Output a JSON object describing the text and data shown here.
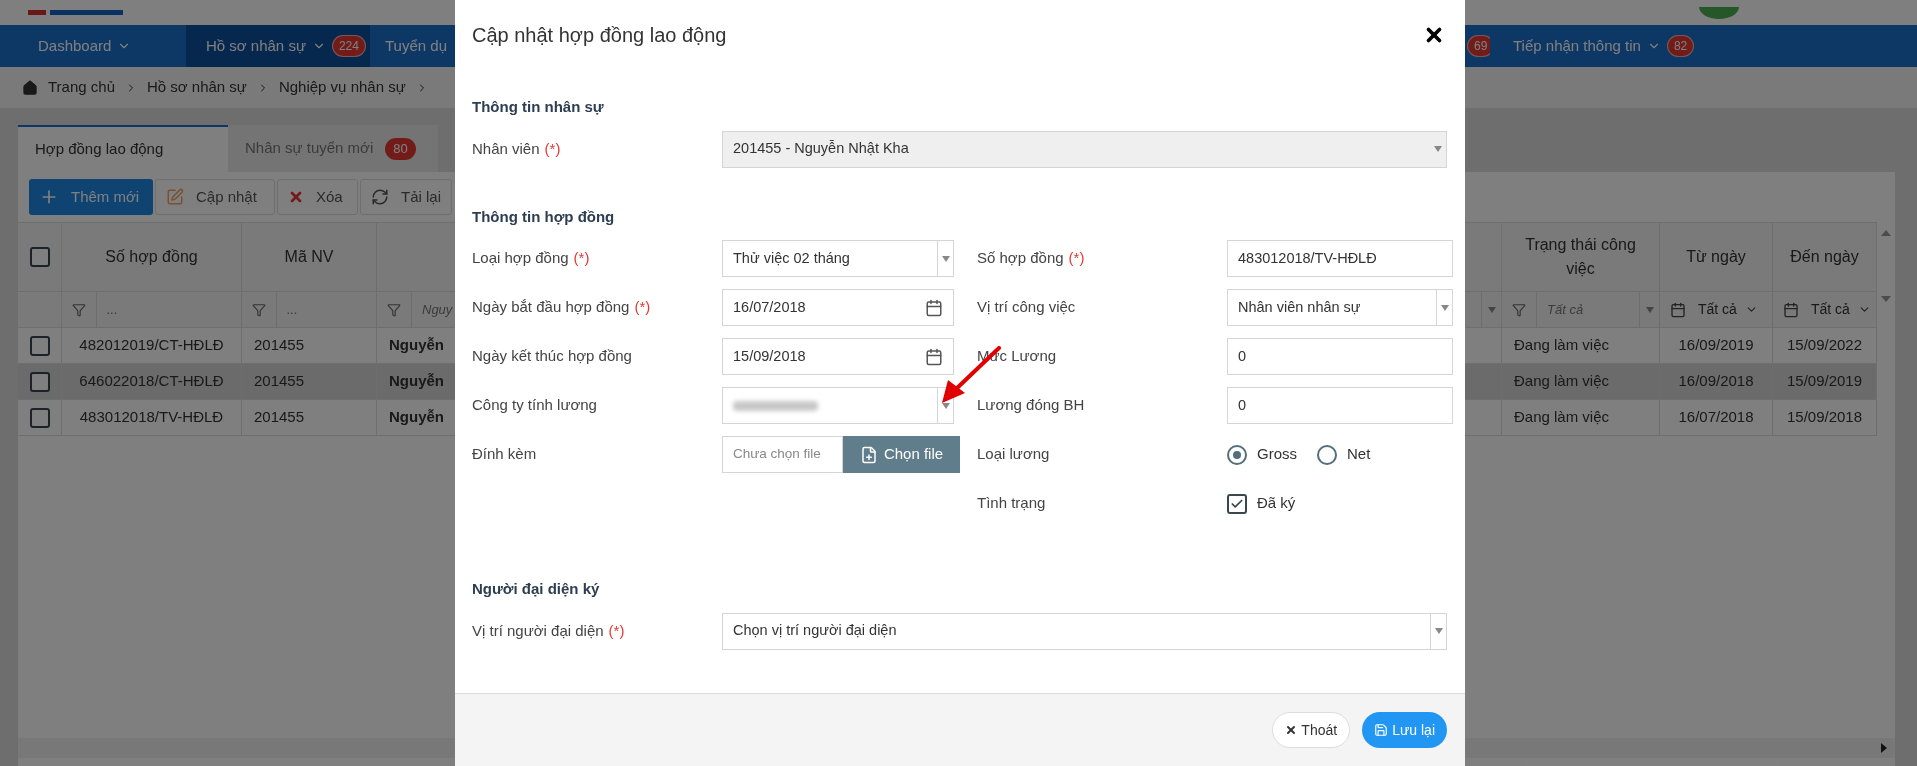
{
  "nav": {
    "left_items": [
      {
        "label": "Dashboard",
        "selected": false,
        "dropdown": true
      },
      {
        "label": "Hồ sơ nhân sự",
        "selected": true,
        "dropdown": true,
        "badge": "224"
      },
      {
        "label": "Tuyển dụ",
        "selected": false
      }
    ],
    "right_items": [
      {
        "badge": "69",
        "selected": false
      },
      {
        "label": "Tiếp nhận thông tin",
        "selected": false,
        "dropdown": true,
        "badge": "82"
      }
    ]
  },
  "breadcrumb": [
    "Trang chủ",
    "Hồ sơ nhân sự",
    "Nghiệp vụ nhân sự"
  ],
  "tabs": [
    {
      "label": "Hợp đồng lao động",
      "selected": true
    },
    {
      "label": "Nhân sự tuyển mới",
      "selected": false,
      "badge": "80"
    }
  ],
  "toolbar": [
    {
      "kind": "add",
      "label": "Thêm mới"
    },
    {
      "kind": "edit",
      "label": "Cập nhật"
    },
    {
      "kind": "delete",
      "label": "Xóa"
    },
    {
      "kind": "reload",
      "label": "Tải lại"
    }
  ],
  "table": {
    "all_checked": false,
    "columns": [
      {
        "label": "Số hợp đồng",
        "filter": {
          "kind": "text",
          "placeholder": "..."
        }
      },
      {
        "label": "Mã NV",
        "filter": {
          "kind": "text",
          "placeholder": "..."
        }
      },
      {
        "filter": {
          "kind": "select",
          "placeholder": "Nguy"
        }
      },
      {
        "label": "Trạng thái công việc",
        "filter": {
          "kind": "select",
          "placeholder": "Tất cả"
        }
      },
      {
        "label": "Từ ngày",
        "filter": {
          "kind": "date",
          "placeholder": "Tất cả"
        }
      },
      {
        "label": "Đến ngày",
        "filter": {
          "kind": "date",
          "placeholder": "Tất cả"
        }
      }
    ],
    "rows": [
      {
        "checked": false,
        "selected": false,
        "cells": [
          "482012019/CT-HĐLĐ",
          "201455",
          "Nguyễn",
          "Đang làm việc",
          "16/09/2019",
          "15/09/2022"
        ]
      },
      {
        "checked": false,
        "selected": true,
        "cells": [
          "646022018/CT-HĐLĐ",
          "201455",
          "Nguyễn",
          "Đang làm việc",
          "16/09/2018",
          "15/09/2019"
        ]
      },
      {
        "checked": false,
        "selected": false,
        "cells": [
          "483012018/TV-HĐLĐ",
          "201455",
          "Nguyễn",
          "Đang làm việc",
          "16/07/2018",
          "15/09/2018"
        ]
      }
    ]
  },
  "modal": {
    "title": "Cập nhật hợp đồng lao động",
    "staff_section": {
      "title": "Thông tin nhân sự",
      "field": {
        "label": "Nhân viên",
        "required_mark": "(*)",
        "kind": "select",
        "value": "201455 - Nguyễn Nhật Kha",
        "disabled": true
      }
    },
    "contract_section": {
      "title": "Thông tin hợp đồng",
      "left_fields": [
        {
          "label": "Loại hợp đồng",
          "required_mark": "(*)",
          "kind": "select",
          "value": "Thử việc 02 tháng"
        },
        {
          "label": "Ngày bắt đầu hợp đồng",
          "required_mark": "(*)",
          "kind": "date",
          "value": "16/07/2018"
        },
        {
          "label": "Ngày kết thúc hợp đồng",
          "kind": "date",
          "value": "15/09/2018"
        },
        {
          "label": "Công ty tính lương",
          "kind": "select",
          "obscured": true
        },
        {
          "label": "Đính kèm",
          "kind": "file",
          "placeholder": "Chưa chọn file",
          "button": "Chọn file"
        }
      ],
      "right_fields": [
        {
          "label": "Số hợp đồng",
          "required_mark": "(*)",
          "kind": "text",
          "value": "483012018/TV-HĐLĐ"
        },
        {
          "label": "Vị trí công việc",
          "kind": "select",
          "value": "Nhân viên nhân sự"
        },
        {
          "label": "Mức Lương",
          "kind": "text",
          "value": "0"
        },
        {
          "label": "Lương đóng BH",
          "kind": "text",
          "value": "0"
        },
        {
          "label": "Loại lương",
          "kind": "radio",
          "options": [
            {
              "label": "Gross",
              "selected": true
            },
            {
              "label": "Net",
              "selected": false
            }
          ]
        },
        {
          "label": "Tình trạng",
          "kind": "checkbox",
          "option": {
            "label": "Đã ký",
            "checked": true
          }
        }
      ]
    },
    "signer_section": {
      "title": "Người đại diện ký",
      "field": {
        "label": "Vị trí người đại diện",
        "required_mark": "(*)",
        "kind": "select",
        "placeholder": "Chọn vị trí người đại diện",
        "disabled": false
      }
    },
    "buttons": [
      {
        "kind": "close",
        "label": "Thoát"
      },
      {
        "kind": "save",
        "label": "Lưu lại"
      }
    ]
  }
}
